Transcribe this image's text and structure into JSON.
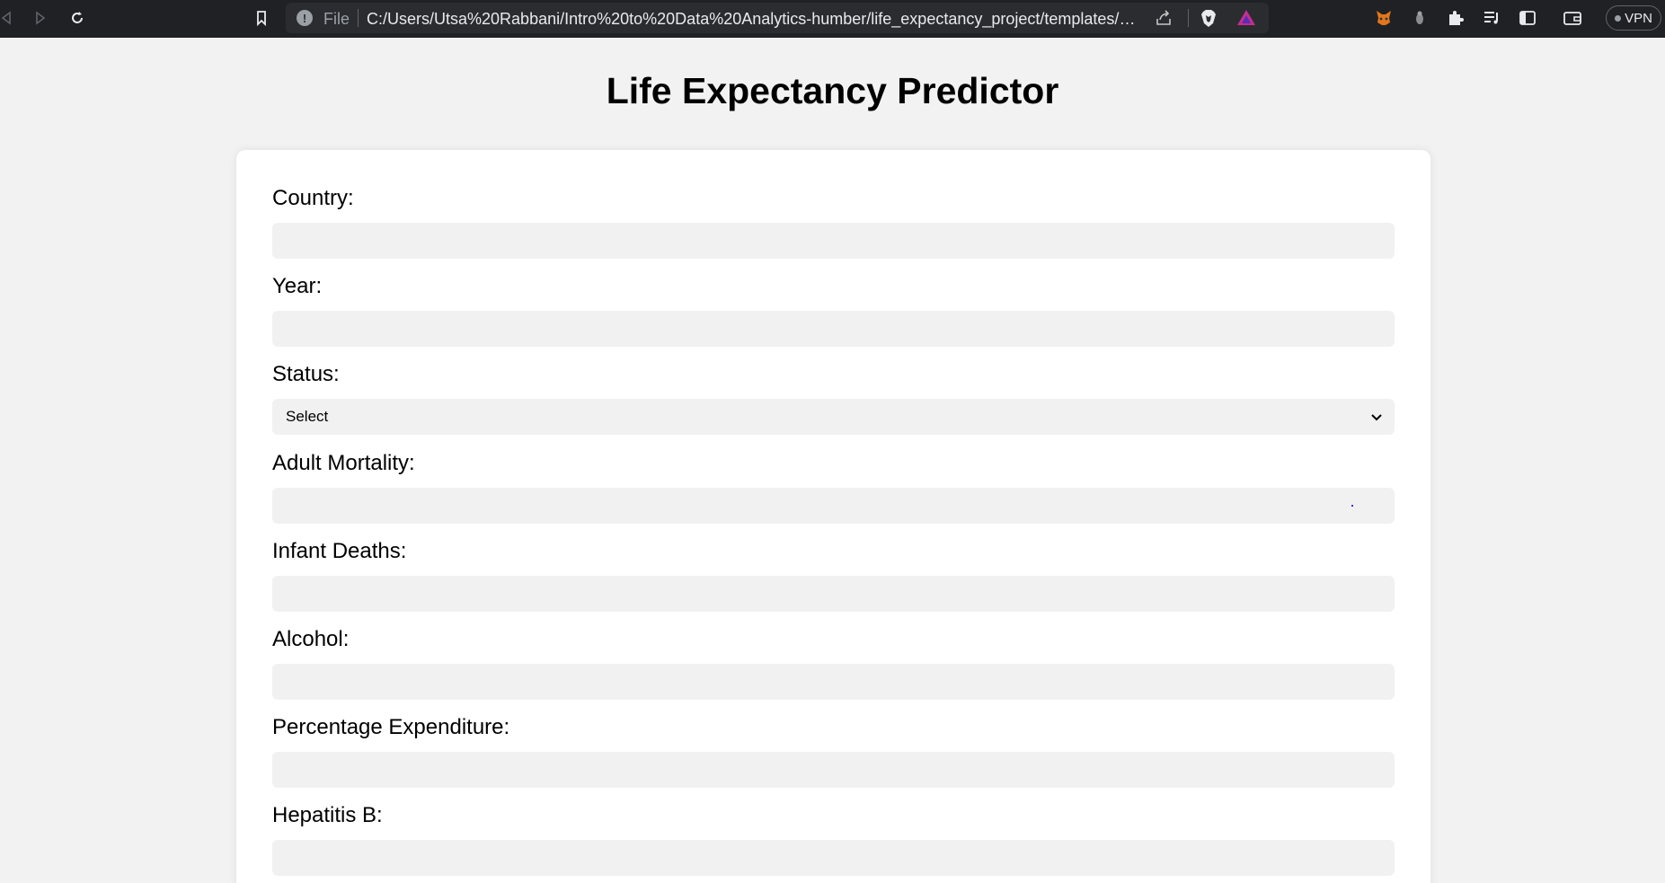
{
  "browser": {
    "file_label": "File",
    "url": "C:/Users/Utsa%20Rabbani/Intro%20to%20Data%20Analytics-humber/life_expectancy_project/templates/home...",
    "vpn_label": "VPN"
  },
  "page": {
    "title": "Life Expectancy Predictor"
  },
  "form": {
    "fields": [
      {
        "label": "Country:",
        "type": "text",
        "value": ""
      },
      {
        "label": "Year:",
        "type": "text",
        "value": ""
      },
      {
        "label": "Status:",
        "type": "select",
        "selected": "Select"
      },
      {
        "label": "Adult Mortality:",
        "type": "text",
        "value": ""
      },
      {
        "label": "Infant Deaths:",
        "type": "text",
        "value": ""
      },
      {
        "label": "Alcohol:",
        "type": "text",
        "value": ""
      },
      {
        "label": "Percentage Expenditure:",
        "type": "text",
        "value": ""
      },
      {
        "label": "Hepatitis B:",
        "type": "text",
        "value": ""
      }
    ]
  },
  "colors": {
    "page_bg": "#f2f2f2",
    "toolbar_bg": "#202124",
    "input_bg": "#f1f1f1",
    "card_bg": "#ffffff"
  }
}
